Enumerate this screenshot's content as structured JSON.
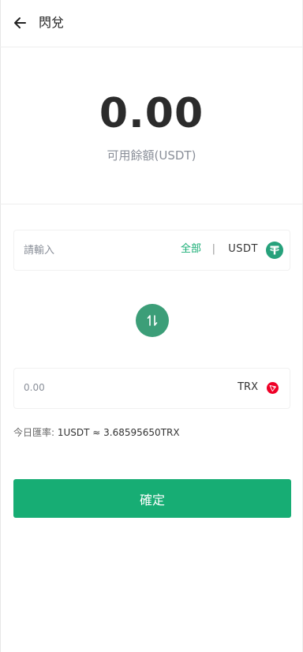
{
  "header": {
    "title": "閃兌"
  },
  "balance": {
    "value": "0.00",
    "label": "可用餘額(USDT)"
  },
  "from": {
    "placeholder": "請輸入",
    "all_label": "全部",
    "separator": "|",
    "coin": "USDT",
    "coin_icon": "tether-icon",
    "coin_color": "#26a17b"
  },
  "to": {
    "amount": "0.00",
    "coin": "TRX",
    "coin_icon": "tron-icon",
    "coin_color": "#ef0027"
  },
  "swap": {
    "icon": "swap-arrows-icon",
    "color": "#3c9e78"
  },
  "rate": {
    "label": "今日匯率:",
    "value": "1USDT ≈ 3.68595650TRX"
  },
  "confirm": {
    "label": "確定",
    "color": "#17ad74"
  }
}
